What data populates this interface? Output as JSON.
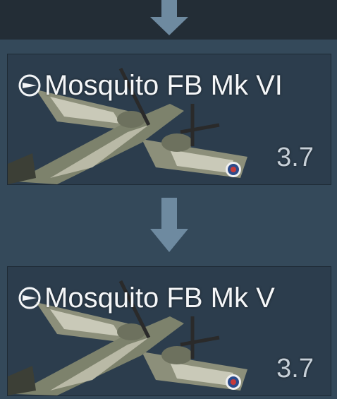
{
  "colors": {
    "background": "#34495a",
    "card": "#2c3d4d",
    "arrow": "#6e8aa0",
    "title_text": "#f4f6f8",
    "rank_text": "#c7d0d8"
  },
  "research_tree": {
    "items": [
      {
        "name": "Mosquito FB Mk VI",
        "battle_rating": "3.7",
        "nation_icon": "uk-roundel-icon"
      },
      {
        "name": "Mosquito FB Mk V",
        "battle_rating": "3.7",
        "nation_icon": "uk-roundel-icon"
      }
    ]
  }
}
